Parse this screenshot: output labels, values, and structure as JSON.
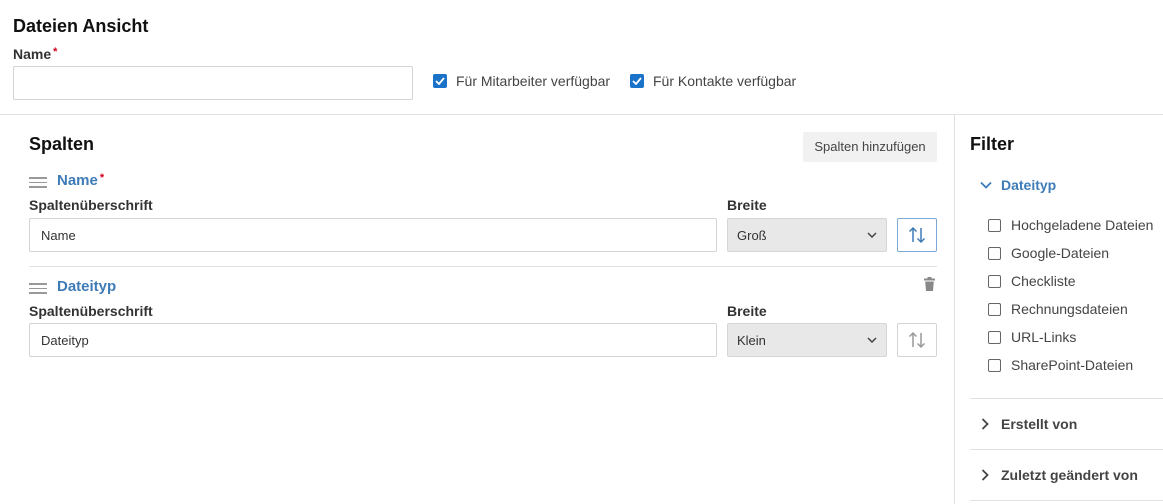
{
  "header": {
    "title": "Dateien Ansicht",
    "name_label": "Name",
    "required_mark": "*",
    "name_value": "",
    "checkbox_employees": {
      "label": "Für Mitarbeiter verfügbar",
      "checked": true
    },
    "checkbox_contacts": {
      "label": "Für Kontakte verfügbar",
      "checked": true
    }
  },
  "columns": {
    "heading": "Spalten",
    "add_button": "Spalten hinzufügen",
    "items": [
      {
        "name": "Name",
        "required": true,
        "heading_label": "Spaltenüberschrift",
        "heading_value": "Name",
        "width_label": "Breite",
        "width_value": "Groß",
        "sort_active": true
      },
      {
        "name": "Dateityp",
        "required": false,
        "heading_label": "Spaltenüberschrift",
        "heading_value": "Dateityp",
        "width_label": "Breite",
        "width_value": "Klein",
        "sort_active": false
      }
    ]
  },
  "filter": {
    "heading": "Filter",
    "groups": [
      {
        "label": "Dateityp",
        "expanded": true,
        "options": [
          {
            "label": "Hochgeladene Dateien",
            "checked": false
          },
          {
            "label": "Google-Dateien",
            "checked": false
          },
          {
            "label": "Checkliste",
            "checked": false
          },
          {
            "label": "Rechnungsdateien",
            "checked": false
          },
          {
            "label": "URL-Links",
            "checked": false
          },
          {
            "label": "SharePoint-Dateien",
            "checked": false
          }
        ]
      },
      {
        "label": "Erstellt von",
        "expanded": false
      },
      {
        "label": "Zuletzt geändert von",
        "expanded": false
      }
    ]
  },
  "colors": {
    "accent": "#3e7cb8",
    "checkbox": "#1a73c9",
    "required": "#d0021b"
  }
}
